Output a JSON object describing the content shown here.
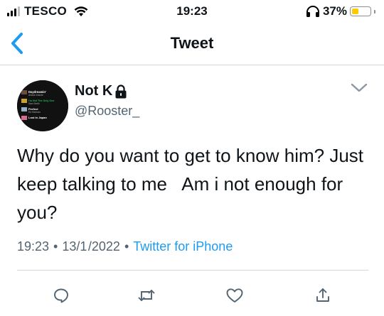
{
  "status_bar": {
    "carrier": "TESCO",
    "time": "19:23",
    "battery_percent": "37%",
    "battery_level": 0.37,
    "battery_color": "#ffcc00"
  },
  "nav": {
    "title": "Tweet",
    "back_icon": "chevron-left-icon",
    "accent": "#1d9bf0"
  },
  "tweet": {
    "author_name": "Not K",
    "protected_icon": "lock-icon",
    "handle": "@Rooster_",
    "text": "Why do you want to get to know him? Just keep talking to me   Am i not enough for you?",
    "time": "19:23",
    "separator": "•",
    "date": "13/1 /2022",
    "source": "Twitter for iPhone",
    "avatar_playlist": [
      "Daydreamin'",
      "Ariana Grande",
      "I'm Not The Only One",
      "Sam Smith",
      "Perfect",
      "Ed Sheeran",
      "Lost In Japan"
    ]
  },
  "actions": [
    {
      "name": "reply-button",
      "icon": "reply-icon"
    },
    {
      "name": "retweet-button",
      "icon": "retweet-icon"
    },
    {
      "name": "like-button",
      "icon": "heart-icon"
    },
    {
      "name": "share-button",
      "icon": "share-icon"
    }
  ],
  "colors": {
    "text": "#0f1419",
    "secondary": "#536471",
    "link": "#1d9bf0",
    "divider": "#cfd9de"
  }
}
